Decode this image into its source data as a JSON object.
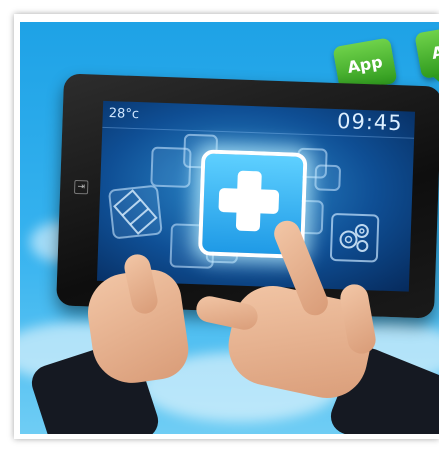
{
  "badges": {
    "primary_label": "App",
    "secondary_label": "A",
    "color": "#3aa829"
  },
  "screen": {
    "temperature": "28°c",
    "time": "09:45",
    "accent_color": "#1f9ae6"
  },
  "icons": {
    "featured": "medical-cross-icon",
    "others": [
      "film-strip-icon",
      "gear-icon",
      "tablet-side-button-icon"
    ]
  }
}
